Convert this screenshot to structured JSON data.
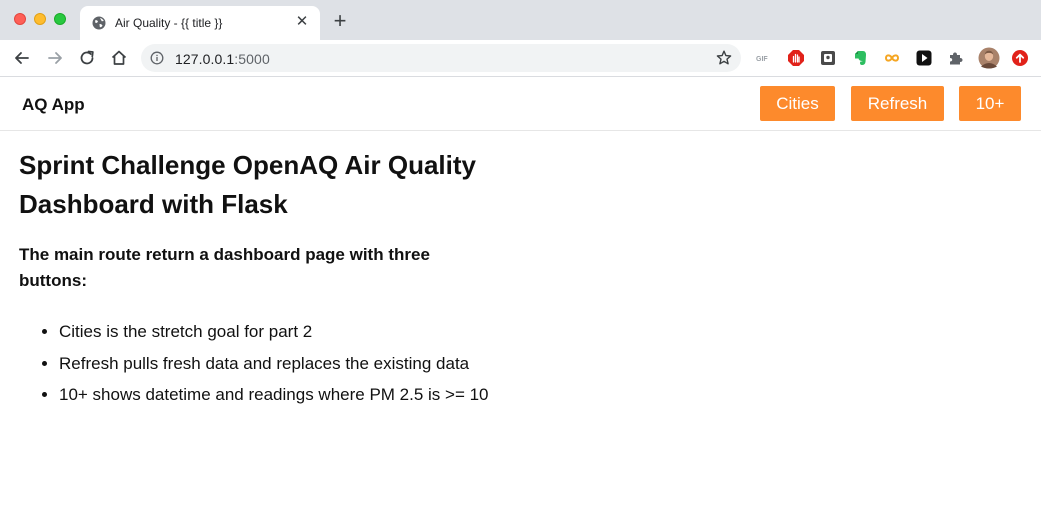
{
  "browser": {
    "tab_title": "Air Quality - {{ title }}",
    "tab_close_glyph": "✕",
    "new_tab_glyph": "+",
    "url_host": "127.0.0.1",
    "url_port": ":5000",
    "extensions": [
      "gif-extension-icon",
      "adblock-icon",
      "keeper-icon",
      "evernote-icon",
      "infinity-icon",
      "play-icon",
      "puzzle-extensions-icon",
      "profile-avatar-icon",
      "update-icon"
    ]
  },
  "app": {
    "brand": "AQ App",
    "buttons": {
      "cities": "Cities",
      "refresh": "Refresh",
      "ten_plus": "10+"
    },
    "accent_color": "#fd8a2c"
  },
  "main": {
    "heading": "Sprint Challenge OpenAQ Air Quality Dashboard with Flask",
    "subheading": "The main route return a dashboard page with three buttons:",
    "bullets": [
      "Cities is the stretch goal for part 2",
      "Refresh pulls fresh data and replaces the existing data",
      "10+ shows datetime and readings where PM 2.5 is >= 10"
    ]
  }
}
